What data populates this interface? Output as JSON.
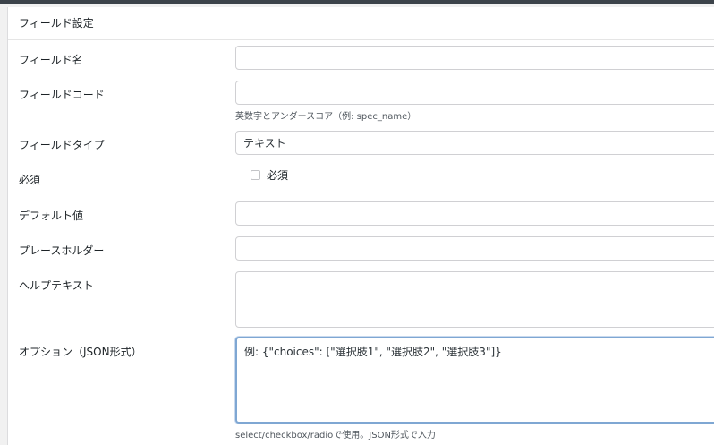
{
  "panel": {
    "title": "フィールド設定"
  },
  "fields": {
    "name": {
      "label": "フィールド名",
      "value": ""
    },
    "code": {
      "label": "フィールドコード",
      "value": "",
      "hint": "英数字とアンダースコア（例: spec_name）"
    },
    "type": {
      "label": "フィールドタイプ",
      "selected": "テキスト"
    },
    "required": {
      "label": "必須",
      "checkbox_label": "必須",
      "checked": false
    },
    "default_value": {
      "label": "デフォルト値",
      "value": ""
    },
    "placeholder": {
      "label": "プレースホルダー",
      "value": ""
    },
    "help_text": {
      "label": "ヘルプテキスト",
      "value": ""
    },
    "options": {
      "label": "オプション（JSON形式）",
      "placeholder": "例: {\"choices\": [\"選択肢1\", \"選択肢2\", \"選択肢3\"]}",
      "hint": "select/checkbox/radioで使用。JSON形式で入力"
    }
  },
  "colors": {
    "topbar": "#3c434a",
    "panel_bg": "#ffffff",
    "page_bg": "#f1f1f1",
    "focus_border": "#7fa7d3"
  }
}
